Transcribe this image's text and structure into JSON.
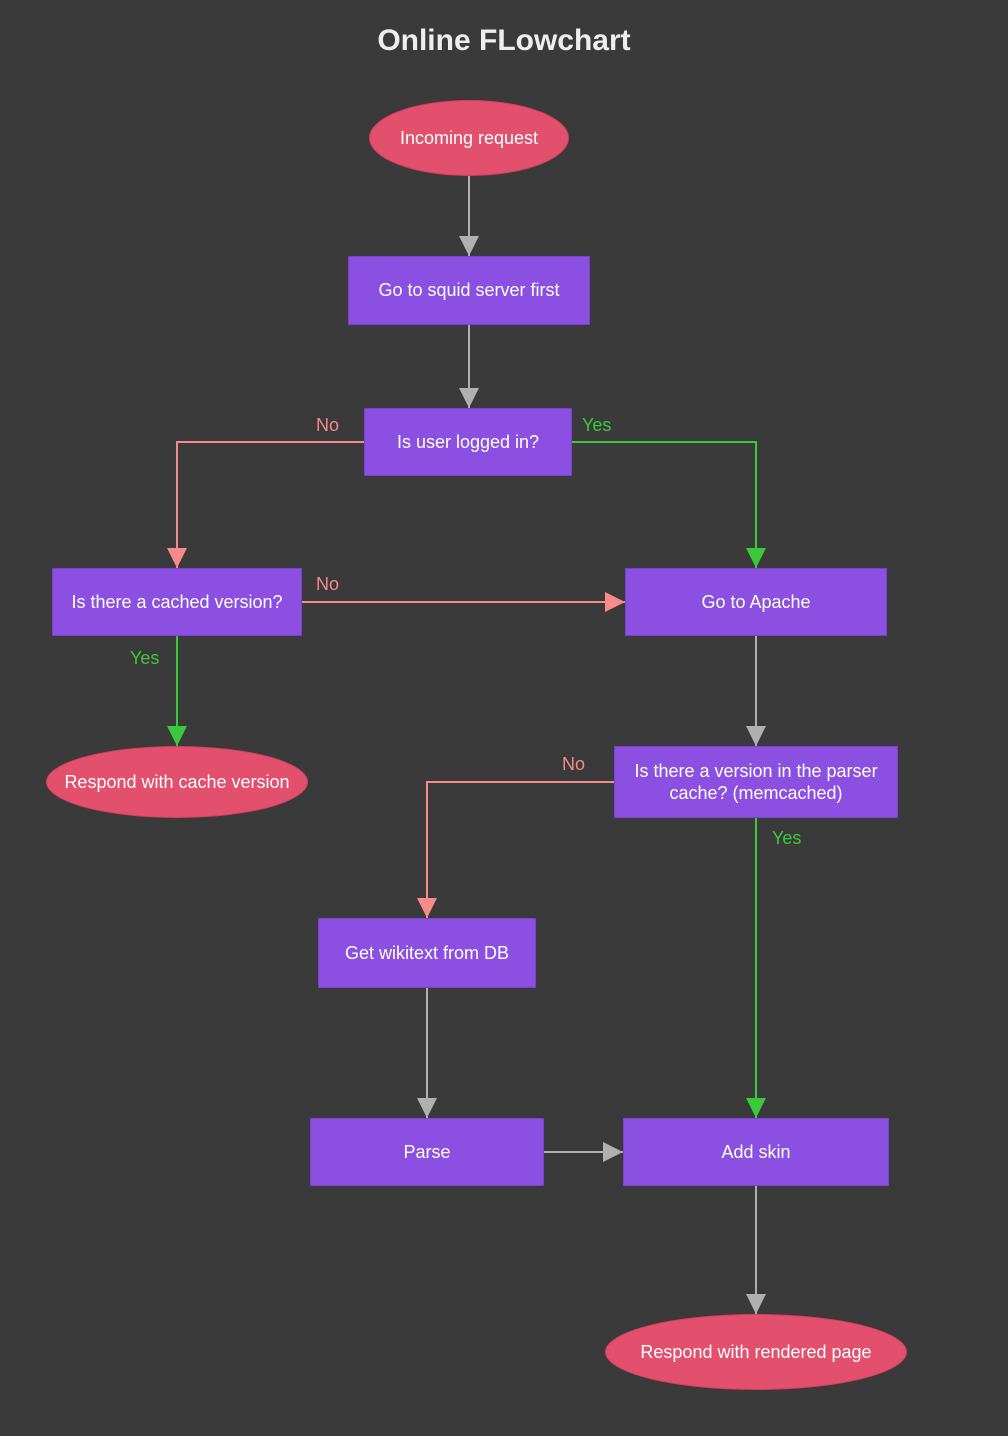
{
  "title": "Online FLowchart",
  "colors": {
    "background": "#3a3a3a",
    "ellipse_fill": "#e2506e",
    "rect_fill": "#8b50e2",
    "arrow_gray": "#b0b0b0",
    "arrow_green": "#3ac93a",
    "arrow_red": "#f58b8b"
  },
  "labels": {
    "yes": "Yes",
    "no": "No"
  },
  "nodes": {
    "incoming": {
      "type": "start",
      "text": "Incoming request"
    },
    "squid": {
      "type": "process",
      "text": "Go to squid server first"
    },
    "logged_in": {
      "type": "decision",
      "text": "Is user logged in?"
    },
    "cached": {
      "type": "decision",
      "text": "Is there a cached version?"
    },
    "apache": {
      "type": "process",
      "text": "Go to Apache"
    },
    "cache_resp": {
      "type": "end",
      "text": "Respond with cache version"
    },
    "parser_cache": {
      "type": "decision",
      "text": "Is there a version in the parser cache? (memcached)"
    },
    "wikitext": {
      "type": "process",
      "text": "Get wikitext from DB"
    },
    "parse": {
      "type": "process",
      "text": "Parse"
    },
    "add_skin": {
      "type": "process",
      "text": "Add skin"
    },
    "rendered": {
      "type": "end",
      "text": "Respond with rendered page"
    }
  },
  "edges": [
    {
      "from": "incoming",
      "to": "squid",
      "label": null,
      "color": "gray"
    },
    {
      "from": "squid",
      "to": "logged_in",
      "label": null,
      "color": "gray"
    },
    {
      "from": "logged_in",
      "to": "cached",
      "label": "No",
      "color": "red"
    },
    {
      "from": "logged_in",
      "to": "apache",
      "label": "Yes",
      "color": "green"
    },
    {
      "from": "cached",
      "to": "apache",
      "label": "No",
      "color": "red"
    },
    {
      "from": "cached",
      "to": "cache_resp",
      "label": "Yes",
      "color": "green"
    },
    {
      "from": "apache",
      "to": "parser_cache",
      "label": null,
      "color": "gray"
    },
    {
      "from": "parser_cache",
      "to": "wikitext",
      "label": "No",
      "color": "red"
    },
    {
      "from": "parser_cache",
      "to": "add_skin",
      "label": "Yes",
      "color": "green"
    },
    {
      "from": "wikitext",
      "to": "parse",
      "label": null,
      "color": "gray"
    },
    {
      "from": "parse",
      "to": "add_skin",
      "label": null,
      "color": "gray"
    },
    {
      "from": "add_skin",
      "to": "rendered",
      "label": null,
      "color": "gray"
    }
  ]
}
